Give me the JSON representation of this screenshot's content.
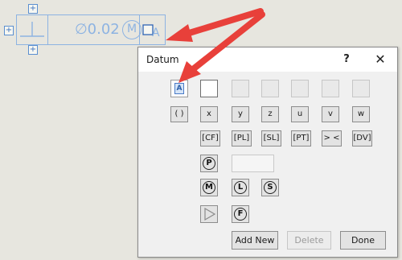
{
  "frame": {
    "tolerance": "∅0.02",
    "modifier": "M",
    "flat_symbol": "⊥",
    "datum_symbol": "A"
  },
  "dialog": {
    "title": "Datum",
    "help": "?",
    "close": "✕",
    "selected_datum": "A",
    "row2": [
      "( )",
      "x",
      "y",
      "z",
      "u",
      "v",
      "w"
    ],
    "row3": [
      "[CF]",
      "[PL]",
      "[SL]",
      "[PT]",
      "> <",
      "[DV]"
    ],
    "modifiers": {
      "p": "P",
      "m": "M",
      "l": "L",
      "s": "S",
      "f": "F"
    },
    "buttons": {
      "add_new": "Add New",
      "delete": "Delete",
      "done": "Done"
    }
  },
  "colors": {
    "annotation_blue": "#8db3e2",
    "arrow_red": "#e8403a"
  }
}
